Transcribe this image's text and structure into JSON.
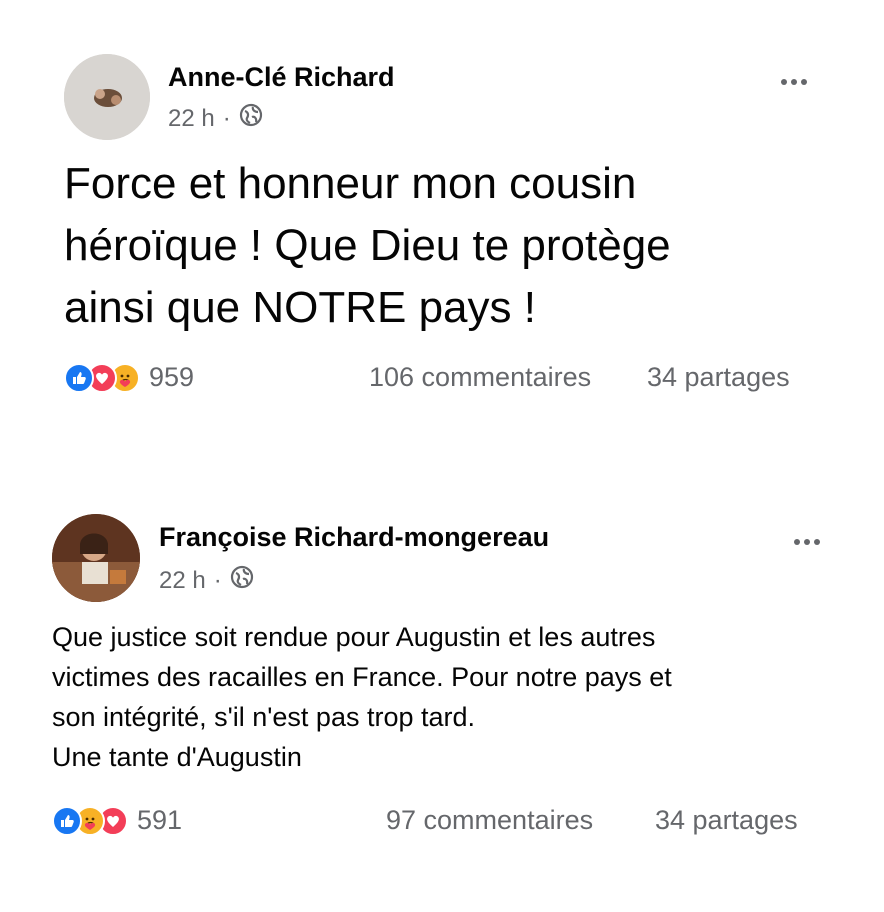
{
  "posts": [
    {
      "author": "Anne-Clé Richard",
      "time": "22 h",
      "separator": "·",
      "text": "Force et honneur mon cousin\nhéroïque ! Que Dieu te protège\nainsi que NOTRE pays !",
      "reaction_icons": [
        "like-icon",
        "love-icon",
        "care-icon"
      ],
      "reaction_count": "959",
      "comments": "106 commentaires",
      "shares": "34 partages"
    },
    {
      "author": "Françoise Richard-mongereau",
      "time": "22 h",
      "separator": "·",
      "text": "Que justice soit rendue pour Augustin et les autres\nvictimes des racailles en France. Pour notre pays et\nson intégrité, s'il n'est pas trop tard.\nUne tante d'Augustin",
      "reaction_icons": [
        "like-icon",
        "care-icon",
        "love-icon"
      ],
      "reaction_count": "591",
      "comments": "97 commentaires",
      "shares": "34 partages"
    }
  ],
  "colors": {
    "like": "#1877f2",
    "love": "#f33e58",
    "care": "#f7b125",
    "secondary_text": "#65676b"
  }
}
